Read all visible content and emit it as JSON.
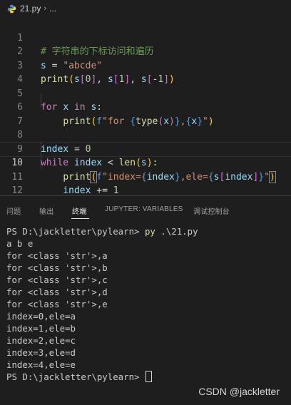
{
  "breadcrumb": {
    "file_name": "21.py",
    "separator": "›",
    "ellipsis": "..."
  },
  "editor": {
    "line_numbers": [
      "1",
      "2",
      "3",
      "4",
      "5",
      "6",
      "7",
      "8",
      "9",
      "10",
      "11",
      "12"
    ],
    "active_line": 10,
    "lines": [
      "# 字符串的下标访问和遍历",
      "s = \"abcde\"",
      "print(s[0], s[1], s[-1])",
      "",
      "for x in s:",
      "    print(f\"for {type(x)},{x}\")",
      "",
      "index = 0",
      "while index < len(s):",
      "    print(f\"index={index},ele={s[index]}\")",
      "    index += 1",
      ""
    ]
  },
  "panel": {
    "tabs": [
      "问题",
      "输出",
      "终端",
      "JUPYTER: VARIABLES",
      "调试控制台"
    ],
    "active_tab": "终端"
  },
  "terminal": {
    "prompt": "PS D:\\jackletter\\pylearn>",
    "command_py": "py",
    "command_arg": ".\\21.py",
    "output": [
      "a b e",
      "for <class 'str'>,a",
      "for <class 'str'>,b",
      "for <class 'str'>,c",
      "for <class 'str'>,d",
      "for <class 'str'>,e",
      "index=0,ele=a",
      "index=1,ele=b",
      "index=2,ele=c",
      "index=3,ele=d",
      "index=4,ele=e"
    ],
    "final_prompt": "PS D:\\jackletter\\pylearn>"
  },
  "watermark": "CSDN @jackletter",
  "colors": {
    "background": "#1e1e1e",
    "comment": "#6a9955",
    "variable": "#9cdcfe",
    "string": "#ce9178",
    "function": "#dcdcaa",
    "keyword": "#c586c0",
    "number": "#b5cea8"
  }
}
